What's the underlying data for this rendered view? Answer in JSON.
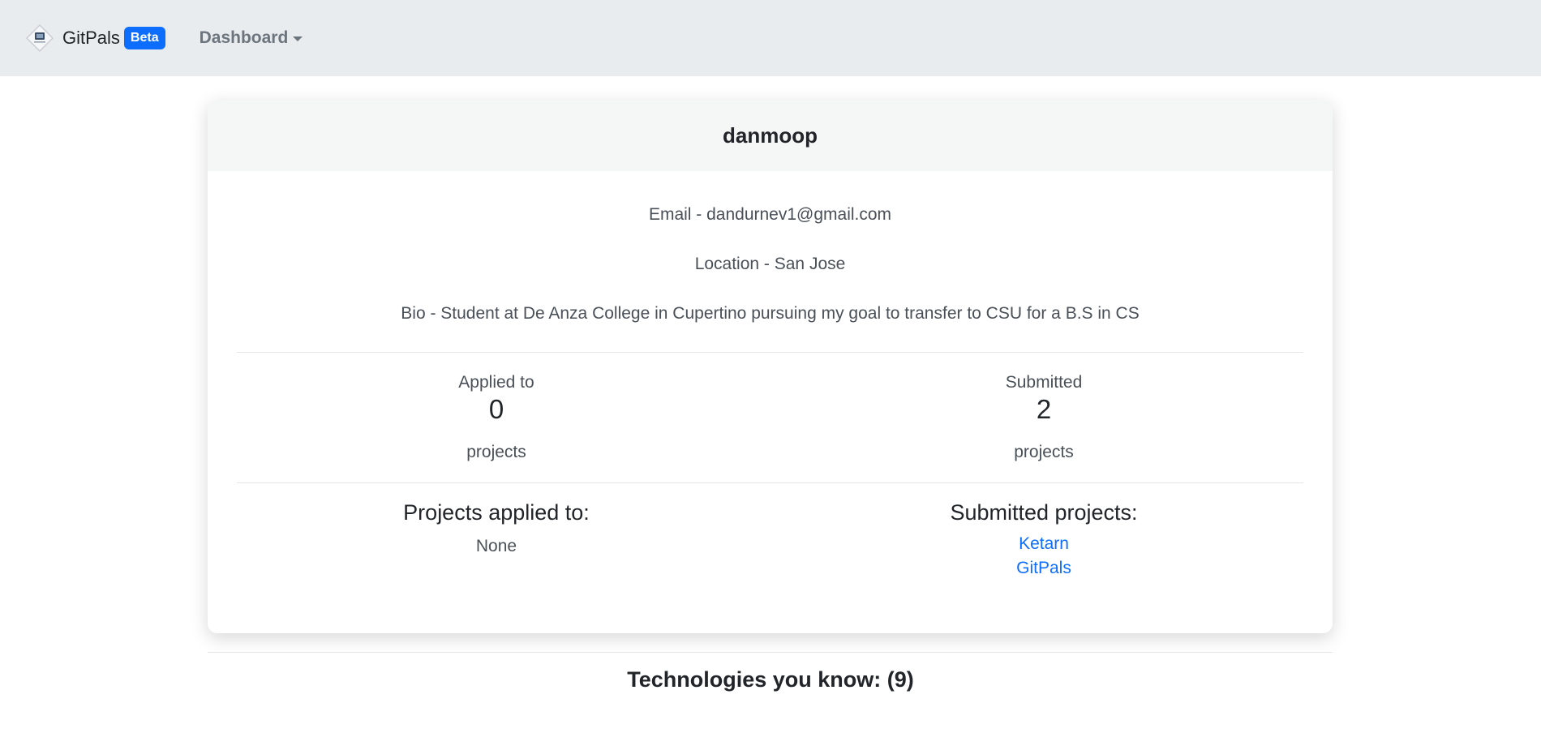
{
  "navbar": {
    "brand_name": "GitPals",
    "beta_badge": "Beta",
    "dashboard_label": "Dashboard",
    "logo_icon": "gitpals-logo-icon",
    "dropdown_icon": "caret-down-icon"
  },
  "profile": {
    "username": "danmoop",
    "email_line": "Email - dandurnev1@gmail.com",
    "location_line": "Location - San Jose",
    "bio_line": "Bio - Student at De Anza College in Cupertino pursuing my goal to transfer to CSU for a B.S in CS"
  },
  "stats": {
    "applied": {
      "label": "Applied to",
      "count": "0",
      "unit": "projects"
    },
    "submitted": {
      "label": "Submitted",
      "count": "2",
      "unit": "projects"
    }
  },
  "projects": {
    "applied_title": "Projects applied to:",
    "applied_empty": "None",
    "submitted_title": "Submitted projects:",
    "submitted_list": [
      "Ketarn",
      "GitPals"
    ]
  },
  "technologies": {
    "heading": "Technologies you know: (9)"
  },
  "colors": {
    "navbar_bg": "#e9ecef",
    "accent": "#0d6efd",
    "card_header_bg": "#f5f6f6"
  }
}
